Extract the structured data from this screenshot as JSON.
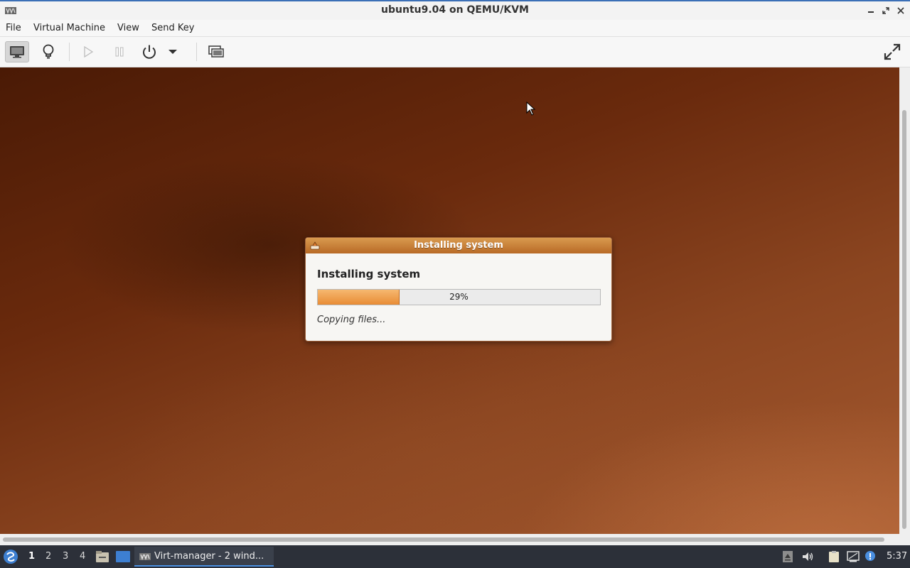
{
  "window": {
    "title": "ubuntu9.04 on QEMU/KVM",
    "controls": [
      "minimize",
      "maximize",
      "close"
    ]
  },
  "menubar": {
    "items": [
      "File",
      "Virtual Machine",
      "View",
      "Send Key"
    ]
  },
  "toolbar": {
    "buttons": [
      {
        "name": "monitor-icon",
        "state": "active"
      },
      {
        "name": "lightbulb-icon"
      },
      {
        "name": "play-icon",
        "state": "disabled"
      },
      {
        "name": "pause-icon",
        "state": "disabled"
      },
      {
        "name": "power-icon"
      },
      {
        "name": "chevron-down-icon"
      },
      {
        "name": "screenshot-icon"
      },
      {
        "name": "fullscreen-icon"
      }
    ]
  },
  "guest": {
    "dialog": {
      "title": "Installing system",
      "heading": "Installing system",
      "progress_label": "29%",
      "progress": 0.29,
      "status": "Copying files..."
    }
  },
  "taskbar": {
    "workspaces": [
      "1",
      "2",
      "3",
      "4"
    ],
    "active_workspace": "1",
    "task_label": "Virt-manager - 2 wind...",
    "clock": "5:37",
    "accent": "#4a8fe0"
  }
}
